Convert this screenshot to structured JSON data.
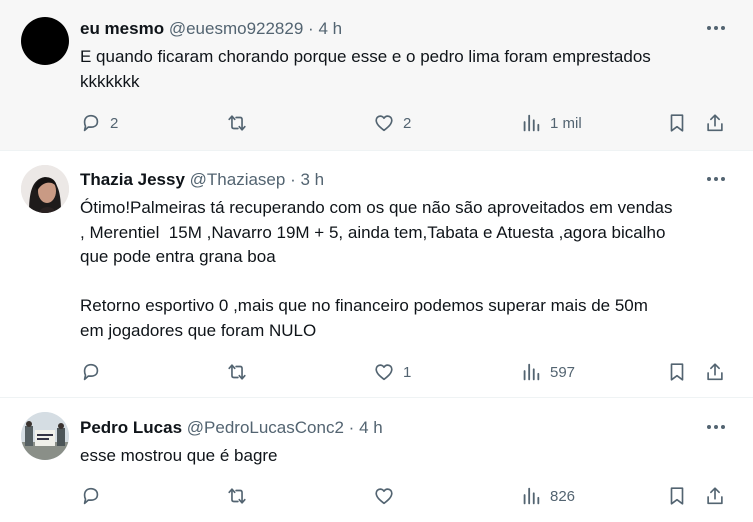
{
  "tweets": [
    {
      "name": "eu mesmo",
      "handle": "@euesmo922829",
      "dot": "·",
      "time": "4 h",
      "lines": [
        "E quando ficaram chorando porque esse e o pedro lima foram emprestados",
        "kkkkkkk"
      ],
      "replies": "2",
      "retweets": "",
      "likes": "2",
      "views": "1 mil"
    },
    {
      "name": "Thazia Jessy",
      "handle": "@Thaziasep",
      "dot": "·",
      "time": "3 h",
      "lines": [
        "Ótimo!Palmeiras tá recuperando com os que não são aproveitados em vendas",
        ", Merentiel  15M ,Navarro 19M + 5, ainda tem,Tabata e Atuesta ,agora bicalho",
        "que pode entra grana boa",
        "",
        "Retorno esportivo 0 ,mais que no financeiro podemos superar mais de 50m",
        "em jogadores que foram NULO"
      ],
      "replies": "",
      "retweets": "",
      "likes": "1",
      "views": "597"
    },
    {
      "name": "Pedro Lucas",
      "handle": "@PedroLucasConc2",
      "dot": "·",
      "time": "4 h",
      "lines": [
        "esse mostrou que é bagre"
      ],
      "replies": "",
      "retweets": "",
      "likes": "",
      "views": "826"
    }
  ],
  "colors": {
    "text": "#0f1419",
    "secondary": "#536471",
    "highlight_bg": "#f7f7f7"
  }
}
